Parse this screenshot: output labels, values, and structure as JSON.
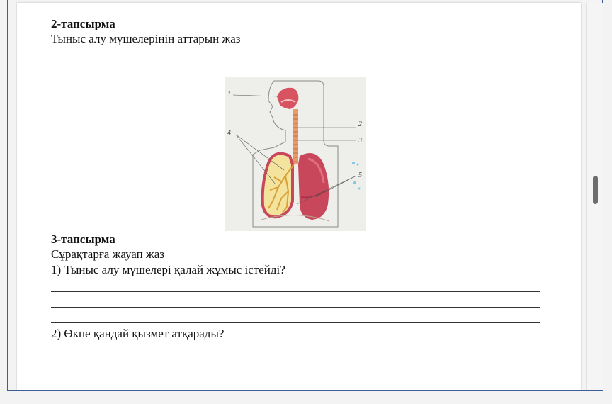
{
  "task2": {
    "heading": "2-тапсырма",
    "instruction": "Тыныс алу мүшелерінің аттарын жаз"
  },
  "figure": {
    "labels": [
      "1",
      "2",
      "3",
      "4",
      "5"
    ]
  },
  "task3": {
    "heading": "3-тапсырма",
    "instruction": "Сұрақтарға жауап жаз",
    "question1": "1) Тыныс алу мүшелері қалай жұмыс істейді?",
    "question2": "2) Өкпе қандай қызмет атқарады?"
  },
  "colors": {
    "frame_border": "#3b5f95",
    "lung_red": "#c8475a",
    "lung_dark": "#a82f45",
    "bronchi_yellow": "#f2d56b"
  }
}
